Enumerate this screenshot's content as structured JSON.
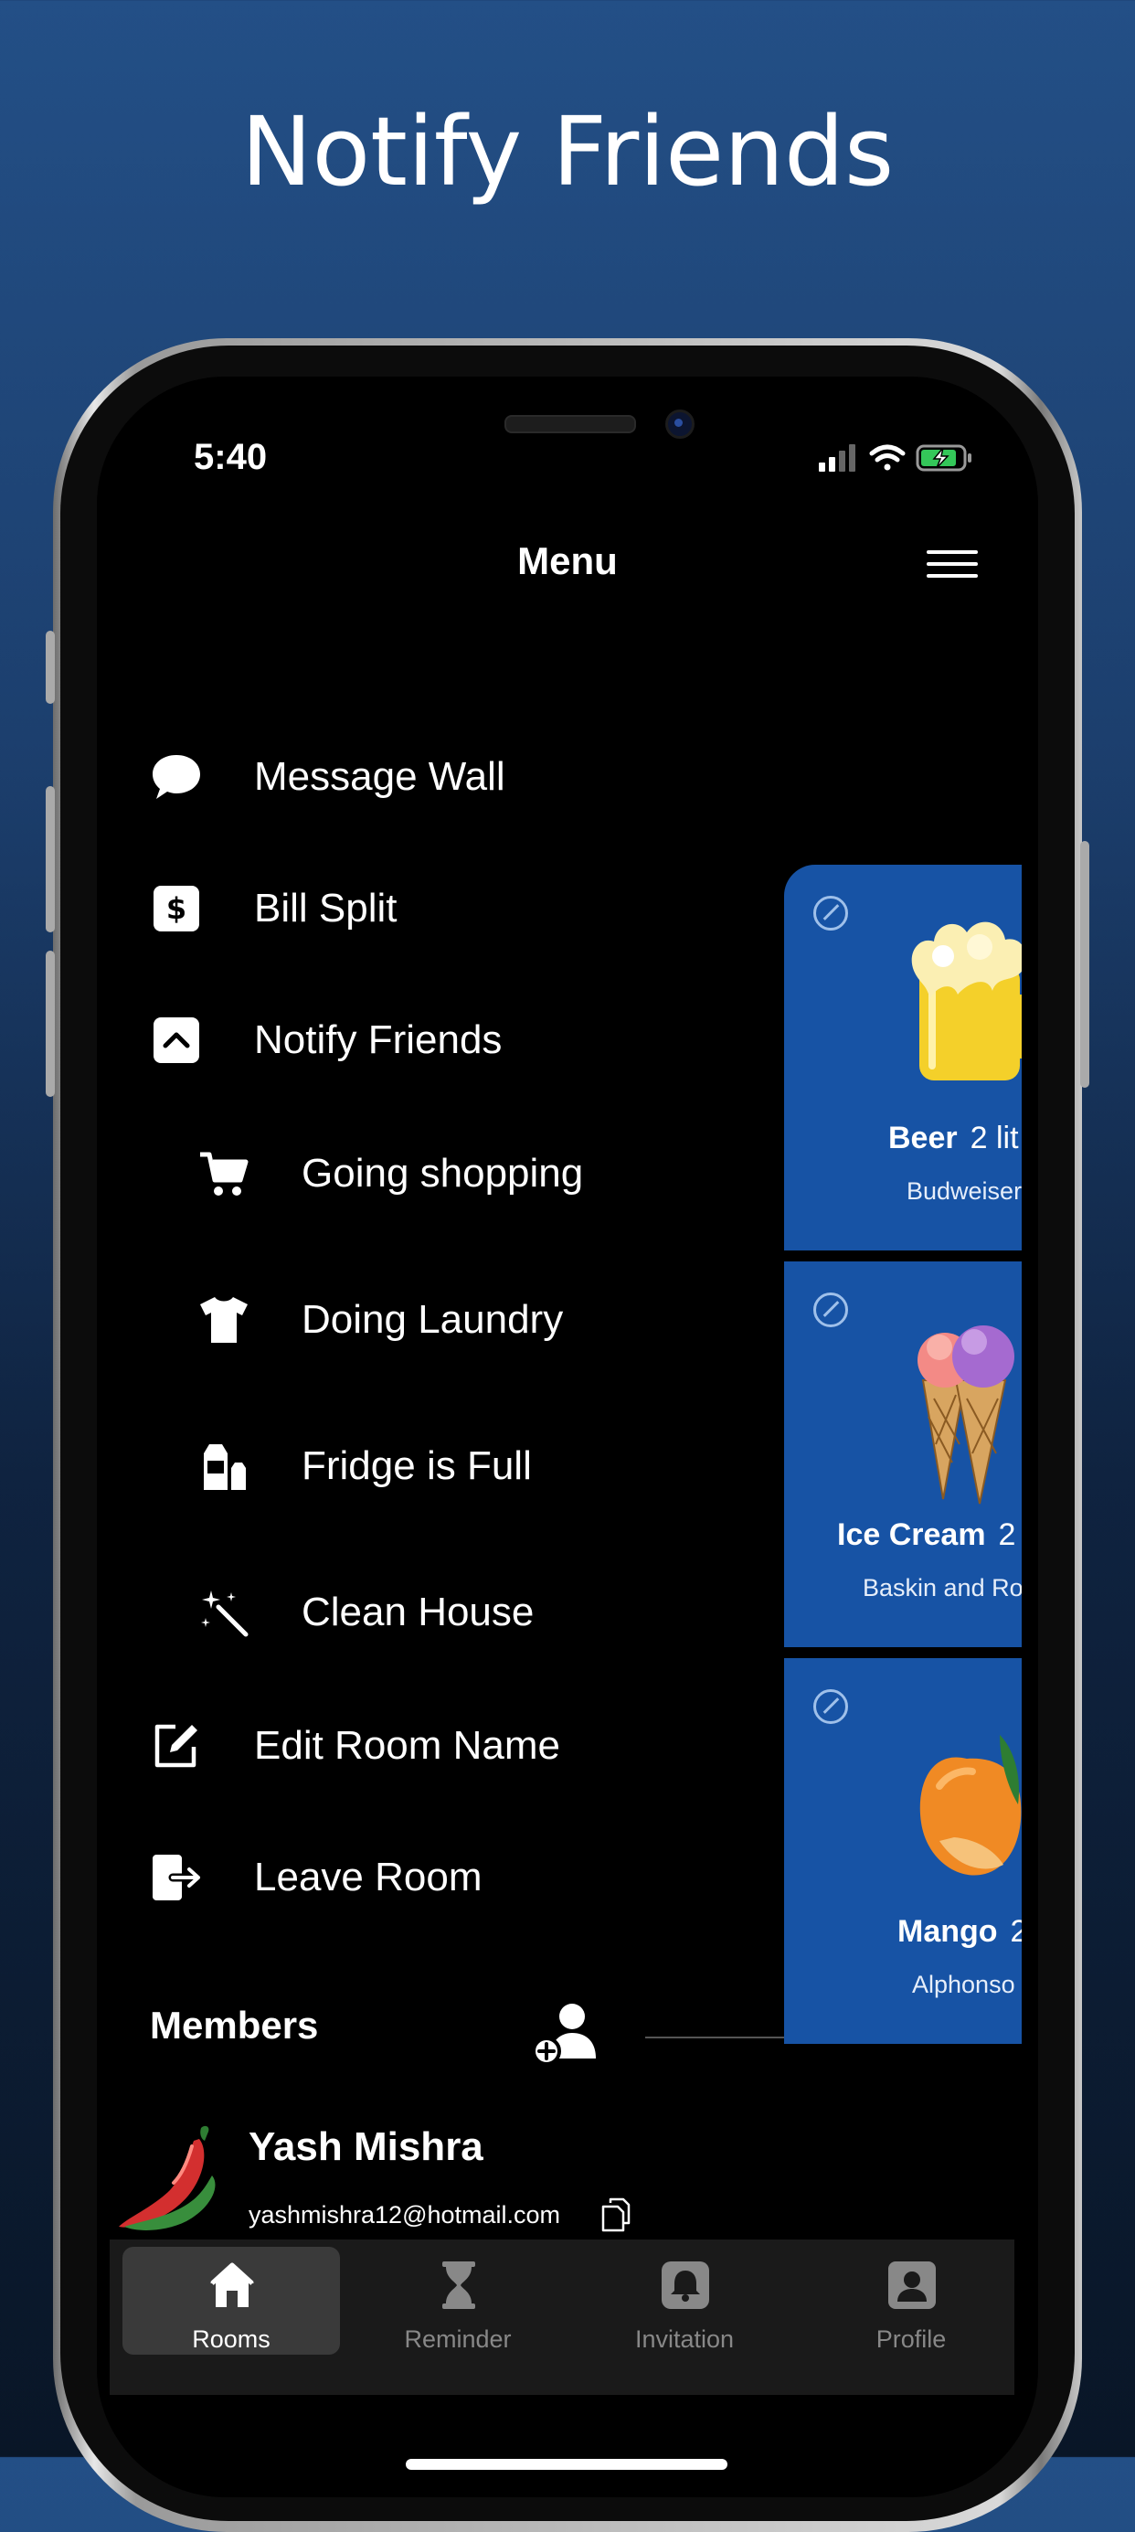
{
  "headline": "Notify Friends",
  "status": {
    "time": "5:40"
  },
  "nav": {
    "title": "Menu"
  },
  "menu": [
    {
      "label": "Message Wall",
      "icon": "speech-bubble-icon"
    },
    {
      "label": "Bill Split",
      "icon": "dollar-icon"
    },
    {
      "label": "Notify Friends",
      "icon": "chevron-up-icon"
    },
    {
      "label": "Going shopping",
      "icon": "cart-icon"
    },
    {
      "label": "Doing Laundry",
      "icon": "tshirt-icon"
    },
    {
      "label": "Fridge is Full",
      "icon": "fridge-items-icon"
    },
    {
      "label": "Clean House",
      "icon": "sparkle-wand-icon"
    },
    {
      "label": "Edit Room Name",
      "icon": "edit-icon"
    },
    {
      "label": "Leave Room",
      "icon": "leave-icon"
    }
  ],
  "cards": [
    {
      "name": "Beer",
      "qty": "2 lit",
      "brand": "Budweiser"
    },
    {
      "name": "Ice Cream",
      "qty": "2",
      "brand": "Baskin and Ro"
    },
    {
      "name": "Mango",
      "qty": "2",
      "brand": "Alphonso"
    }
  ],
  "members": {
    "label": "Members",
    "list": [
      {
        "name": "Yash Mishra",
        "email": "yashmishra12@hotmail.com"
      }
    ]
  },
  "tabs": [
    {
      "label": "Rooms",
      "icon": "home-icon",
      "active": true
    },
    {
      "label": "Reminder",
      "icon": "hourglass-icon",
      "active": false
    },
    {
      "label": "Invitation",
      "icon": "bell-icon",
      "active": false
    },
    {
      "label": "Profile",
      "icon": "person-icon",
      "active": false
    }
  ],
  "colors": {
    "background_top": "#234f86",
    "card": "#1753a5",
    "battery": "#34c759"
  }
}
